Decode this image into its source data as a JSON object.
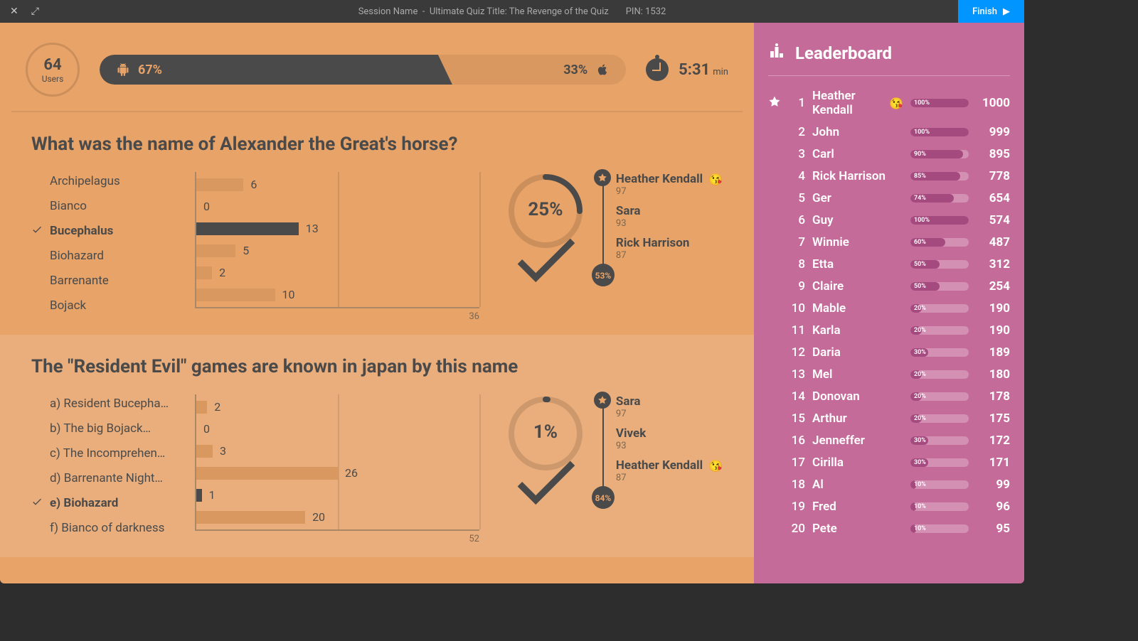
{
  "titlebar": {
    "session": "Session Name",
    "sep": "-",
    "quiz_title": "Ultimate Quiz Title: The Revenge of the Quiz",
    "pin": "PIN: 1532",
    "finish": "Finish"
  },
  "header": {
    "users_count": "64",
    "users_label": "Users",
    "android_pct": "67%",
    "apple_pct": "33%",
    "time": "5:31",
    "time_unit": "min"
  },
  "chart_data": [
    {
      "type": "bar",
      "title": "Answer distribution for Q1",
      "categories": [
        "Archipelagus",
        "Bianco",
        "Bucephalus",
        "Biohazard",
        "Barrenante",
        "Bojack"
      ],
      "values": [
        6,
        0,
        13,
        5,
        2,
        10
      ],
      "xmax": 36,
      "correct_index": 2
    },
    {
      "type": "bar",
      "title": "Answer distribution for Q2",
      "categories": [
        "a) Resident Bucepha…",
        "b) The big Bojack…",
        "c) The Incomprehen…",
        "d) Barrenante Night…",
        "e) Biohazard",
        "f) Bianco of darkness"
      ],
      "values": [
        2,
        0,
        3,
        26,
        1,
        20
      ],
      "xmax": 52,
      "correct_index": 4
    }
  ],
  "questions": [
    {
      "title": "What was the name of Alexander the Great's horse?",
      "answers": [
        {
          "text": "Archipelagus",
          "correct": false,
          "count": "6"
        },
        {
          "text": "Bianco",
          "correct": false,
          "count": "0"
        },
        {
          "text": "Bucephalus",
          "correct": true,
          "count": "13"
        },
        {
          "text": "Biohazard",
          "correct": false,
          "count": "5"
        },
        {
          "text": "Barrenante",
          "correct": false,
          "count": "2"
        },
        {
          "text": "Bojack",
          "correct": false,
          "count": "10"
        }
      ],
      "chart_max": "36",
      "percent": "25%",
      "top3_pct": "53%",
      "top3": [
        {
          "name": "Heather Kendall",
          "emoji": "😘",
          "score": "97"
        },
        {
          "name": "Sara",
          "emoji": "",
          "score": "93"
        },
        {
          "name": "Rick Harrison",
          "emoji": "",
          "score": "87"
        }
      ]
    },
    {
      "title": "The \"Resident Evil\" games are known in japan by this name",
      "answers": [
        {
          "text": "a) Resident Bucepha…",
          "correct": false,
          "count": "2"
        },
        {
          "text": "b) The big Bojack…",
          "correct": false,
          "count": "0"
        },
        {
          "text": "c) The Incomprehen…",
          "correct": false,
          "count": "3"
        },
        {
          "text": "d) Barrenante Night…",
          "correct": false,
          "count": "26"
        },
        {
          "text": "e) Biohazard",
          "correct": true,
          "count": "1"
        },
        {
          "text": "f) Bianco of darkness",
          "correct": false,
          "count": "20"
        }
      ],
      "chart_max": "52",
      "percent": "1%",
      "top3_pct": "84%",
      "top3": [
        {
          "name": "Sara",
          "emoji": "",
          "score": "97"
        },
        {
          "name": "Vivek",
          "emoji": "",
          "score": "93"
        },
        {
          "name": "Heather Kendall",
          "emoji": "😘",
          "score": "87"
        }
      ]
    }
  ],
  "leaderboard": {
    "title": "Leaderboard",
    "entries": [
      {
        "rank": "1",
        "name": "Heather Kendall",
        "emoji": "😘",
        "pct": "100%",
        "score": "1000",
        "medal": true
      },
      {
        "rank": "2",
        "name": "John",
        "pct": "100%",
        "score": "999"
      },
      {
        "rank": "3",
        "name": "Carl",
        "pct": "90%",
        "score": "895"
      },
      {
        "rank": "4",
        "name": "Rick Harrison",
        "pct": "85%",
        "score": "778"
      },
      {
        "rank": "5",
        "name": "Ger",
        "pct": "74%",
        "score": "654"
      },
      {
        "rank": "6",
        "name": "Guy",
        "pct": "100%",
        "score": "574"
      },
      {
        "rank": "7",
        "name": "Winnie",
        "pct": "60%",
        "score": "487"
      },
      {
        "rank": "8",
        "name": "Etta",
        "pct": "50%",
        "score": "312"
      },
      {
        "rank": "9",
        "name": "Claire",
        "pct": "50%",
        "score": "254"
      },
      {
        "rank": "10",
        "name": "Mable",
        "pct": "20%",
        "score": "190"
      },
      {
        "rank": "11",
        "name": "Karla",
        "pct": "20%",
        "score": "190"
      },
      {
        "rank": "12",
        "name": "Daria",
        "pct": "30%",
        "score": "189"
      },
      {
        "rank": "13",
        "name": "Mel",
        "pct": "20%",
        "score": "180"
      },
      {
        "rank": "14",
        "name": "Donovan",
        "pct": "20%",
        "score": "178"
      },
      {
        "rank": "15",
        "name": "Arthur",
        "pct": "20%",
        "score": "175"
      },
      {
        "rank": "16",
        "name": "Jenneffer",
        "pct": "30%",
        "score": "172"
      },
      {
        "rank": "17",
        "name": "Cirilla",
        "pct": "30%",
        "score": "171"
      },
      {
        "rank": "18",
        "name": "Al",
        "pct": "10%",
        "score": "99"
      },
      {
        "rank": "19",
        "name": "Fred",
        "pct": "10%",
        "score": "96"
      },
      {
        "rank": "20",
        "name": "Pete",
        "pct": "10%",
        "score": "95"
      }
    ]
  }
}
